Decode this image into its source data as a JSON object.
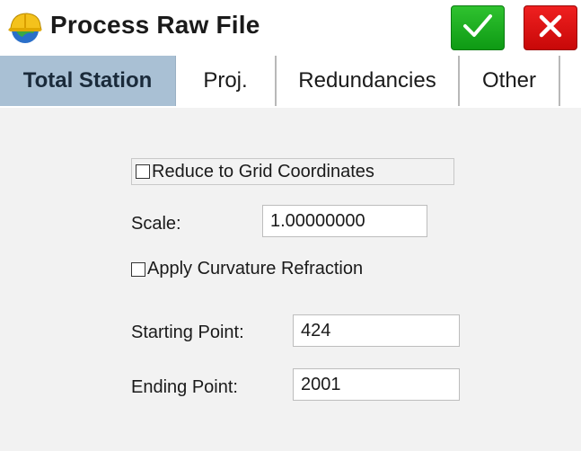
{
  "window": {
    "title": "Process Raw File",
    "icons": {
      "app": "hard-hat-globe-icon",
      "ok": "checkmark-icon",
      "cancel": "close-icon"
    },
    "colors": {
      "ok": "#17a81c",
      "cancel": "#e11414",
      "active_tab": "#a9c0d4"
    }
  },
  "tabs": [
    {
      "label": "Total Station",
      "active": true
    },
    {
      "label": "Proj."
    },
    {
      "label": "Redundancies"
    },
    {
      "label": "Other"
    }
  ],
  "form": {
    "reduce_grid_label": "Reduce to Grid Coordinates",
    "reduce_grid_checked": false,
    "scale_label": "Scale:",
    "scale_value": "1.00000000",
    "curvature_label": "Apply Curvature Refraction",
    "curvature_checked": false,
    "starting_point_label": "Starting Point:",
    "starting_point_value": "424",
    "ending_point_label": "Ending Point:",
    "ending_point_value": "2001"
  }
}
